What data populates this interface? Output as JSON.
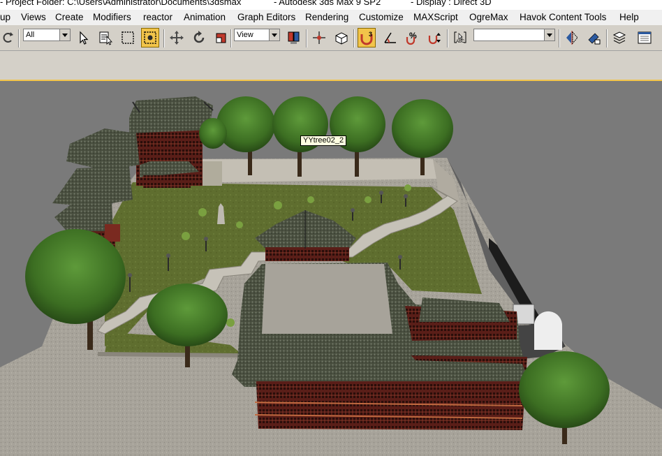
{
  "title_bar": {
    "project_folder": "- Project Folder: C:\\Users\\Administrator\\Documents\\3dsmax",
    "app_name": "- Autodesk 3ds Max 9 SP2",
    "display": "- Display : Direct 3D"
  },
  "menu": {
    "items": [
      "up",
      "Views",
      "Create",
      "Modifiers",
      "reactor",
      "Animation",
      "Graph Editors",
      "Rendering",
      "Customize",
      "MAXScript",
      "OgreMax",
      "Havok Content Tools",
      "Help"
    ]
  },
  "toolbar": {
    "selection_filter": "All",
    "reference_coord": "View",
    "named_selection": ""
  },
  "viewport": {
    "tooltip": "YYtree02_2",
    "active_border_color": "#f2c44a"
  },
  "icons": [
    "undo-icon",
    "select-icon",
    "select-by-name-icon",
    "rect-region-icon",
    "window-crossing-icon",
    "move-icon",
    "rotate-icon",
    "scale-icon",
    "pivot-icon",
    "manipulate-icon",
    "keyboard-shortcut-icon",
    "snap-3d-icon",
    "angle-snap-icon",
    "percent-snap-icon",
    "spinner-snap-icon",
    "edit-named-selection-icon",
    "mirror-icon",
    "align-icon",
    "layer-manager-icon",
    "curve-editor-icon"
  ]
}
